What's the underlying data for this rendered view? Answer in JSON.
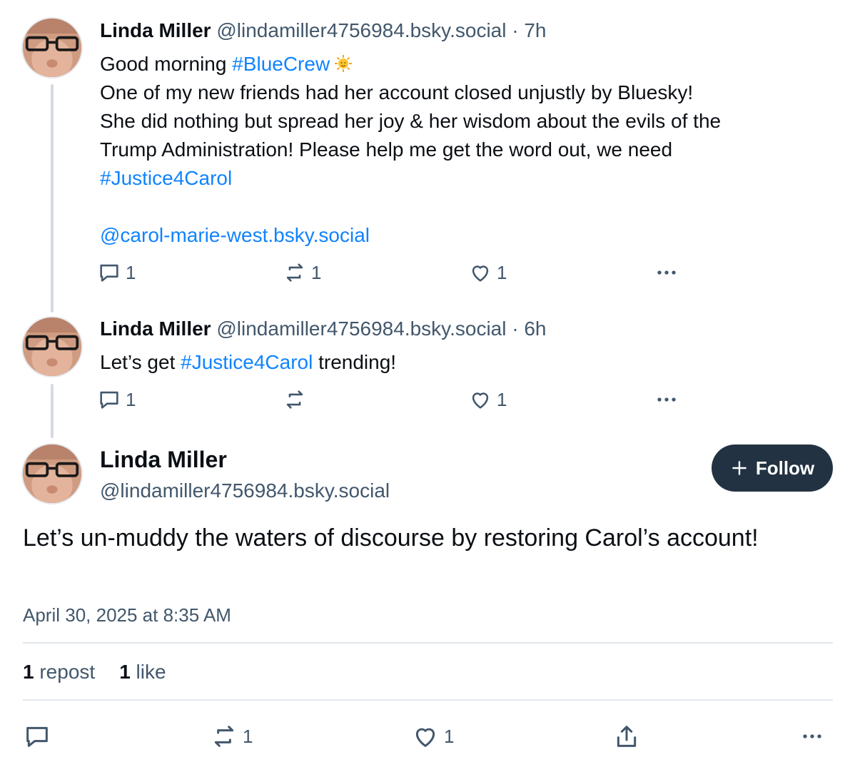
{
  "replies": [
    {
      "author": "Linda Miller",
      "handle": "@lindamiller4756984.bsky.social",
      "separator": "·",
      "time": "7h",
      "greeting": "Good morning ",
      "greeting_tag": "#BlueCrew",
      "line2": "One of my new friends had her account closed unjustly by Bluesky!",
      "line3": "She did nothing but spread her joy & her wisdom about the evils of the",
      "line4": "Trump Administration! Please help me get the word out, we need",
      "line5_tag": "#Justice4Carol",
      "mention": "@carol-marie-west.bsky.social",
      "reply_count": "1",
      "repost_count": "1",
      "like_count": "1"
    },
    {
      "author": "Linda Miller",
      "handle": "@lindamiller4756984.bsky.social",
      "separator": "·",
      "time": "6h",
      "text_before": "Let’s get ",
      "text_tag": "#Justice4Carol",
      "text_after": " trending!",
      "reply_count": "1",
      "repost_count": "",
      "like_count": "1"
    }
  ],
  "main_post": {
    "author": "Linda Miller",
    "handle": "@lindamiller4756984.bsky.social",
    "follow_label": "Follow",
    "text": "Let’s un-muddy the waters of discourse by restoring Carol’s account!",
    "date": "April 30, 2025 at 8:35 AM",
    "repost_count": "1",
    "repost_label": "repost",
    "like_count": "1",
    "like_label": "like",
    "action_repost_count": "1",
    "action_like_count": "1"
  },
  "colors": {
    "link": "#1083fe",
    "muted": "#42576c",
    "follow_bg": "#233242"
  },
  "icons": [
    "reply-icon",
    "repost-icon",
    "like-icon",
    "more-icon",
    "share-icon",
    "plus-icon",
    "sun-emoji"
  ]
}
